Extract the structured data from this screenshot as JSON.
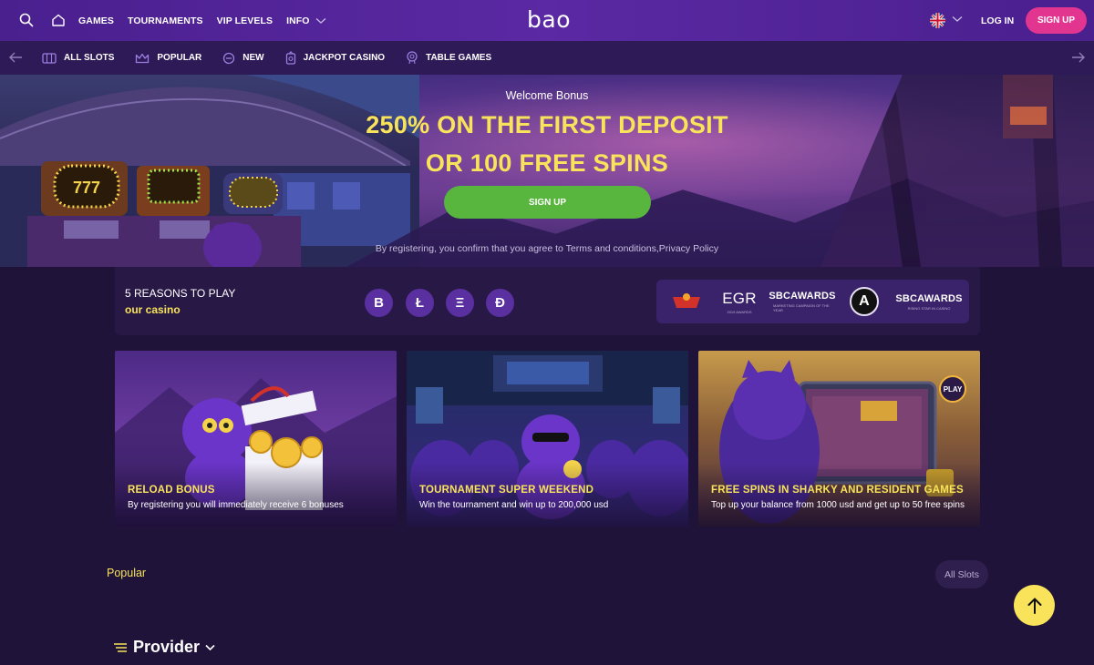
{
  "header": {
    "logo": "bao",
    "nav": [
      "GAMES",
      "TOURNAMENTS",
      "VIP LEVELS",
      "INFO"
    ],
    "login_label": "LOG IN",
    "signup_label": "SIGN UP",
    "signup_color": "#e2358f"
  },
  "categories": [
    {
      "label": "ALL SLOTS",
      "icon": "slots-icon"
    },
    {
      "label": "POPULAR",
      "icon": "crown-icon"
    },
    {
      "label": "NEW",
      "icon": "new-icon"
    },
    {
      "label": "JACKPOT CASINO",
      "icon": "jackpot-icon"
    },
    {
      "label": "TABLE GAMES",
      "icon": "chip-icon"
    }
  ],
  "hero": {
    "subtitle": "Welcome Bonus",
    "title_line1": "250% ON THE FIRST DEPOSIT",
    "title_line2": "OR 100 FREE SPINS",
    "cta_label": "SIGN UP",
    "cta_color": "#58b63e",
    "terms": "By registering, you confirm that you agree to Terms and conditions,Privacy Policy"
  },
  "reasons": {
    "line1": "5 REASONS TO PLAY",
    "line2": "our casino",
    "coins": [
      "B",
      "Ł",
      "Ξ",
      "Ð"
    ],
    "awards": [
      {
        "main": "",
        "sub": ""
      },
      {
        "main": "EGR",
        "sub": "2019 AWARDS"
      },
      {
        "main": "SBCAWARDS",
        "sub": "MARKETING CAMPAIGN OF THE YEAR"
      },
      {
        "main": "A",
        "sub": ""
      },
      {
        "main": "SBCAWARDS",
        "sub": "RISING STAR IN CASINO"
      }
    ]
  },
  "promos": [
    {
      "title": "RELOAD BONUS",
      "subtitle": "By registering you will immediately receive 6 bonuses"
    },
    {
      "title": "TOURNAMENT SUPER WEEKEND",
      "subtitle": "Win the tournament and win up to 200,000 usd"
    },
    {
      "title": "FREE SPINS IN SHARKY AND RESIDENT GAMES",
      "subtitle": "Top up your balance from 1000 usd and get up to 50 free spins",
      "badge": "PLAY"
    }
  ],
  "popular": {
    "title": "Popular",
    "all_slots_label": "All Slots"
  },
  "provider": {
    "label": "Provider"
  },
  "accent_yellow": "#f8e35a"
}
